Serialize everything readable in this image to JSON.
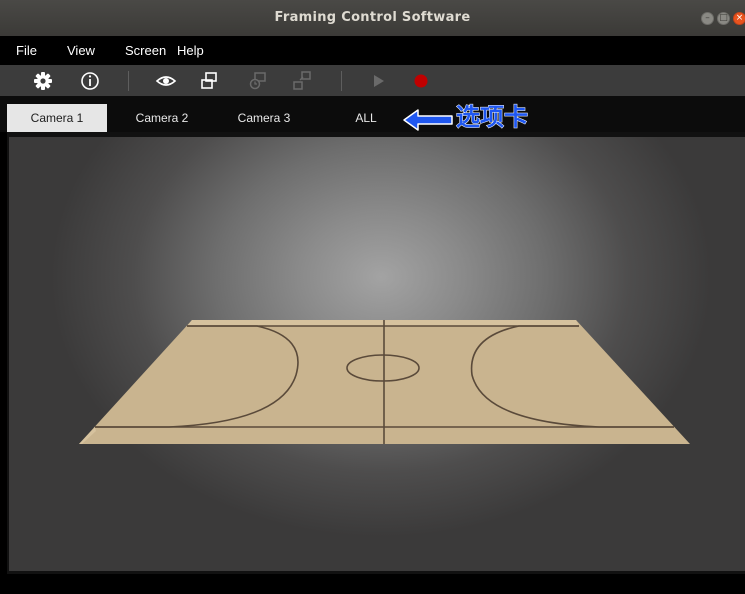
{
  "window": {
    "title": "Framing Control Software",
    "controls": {
      "minimize": "–",
      "maximize": "□",
      "close": "×"
    }
  },
  "menu": {
    "items": [
      "File",
      "View",
      "Screen",
      "Help"
    ]
  },
  "toolbar": {
    "icons": [
      "settings-gear-icon",
      "info-icon",
      "eye-icon",
      "window-layout-icon",
      "window-history-icon",
      "window-resize-icon",
      "play-icon",
      "record-icon"
    ],
    "colors": {
      "icon": "#ffffff",
      "disabled": "#6a6a6a",
      "record": "#c00000"
    }
  },
  "tabs": {
    "items": [
      "Camera 1",
      "Camera 2",
      "Camera 3",
      "ALL"
    ],
    "active": "Camera 1"
  },
  "annotation": {
    "label": "选项卡",
    "color": "#1f57f0"
  },
  "viewport": {
    "scene": "basketball-court",
    "colors": {
      "court": "#c9b48f",
      "lines": "#5a4a3a"
    }
  }
}
